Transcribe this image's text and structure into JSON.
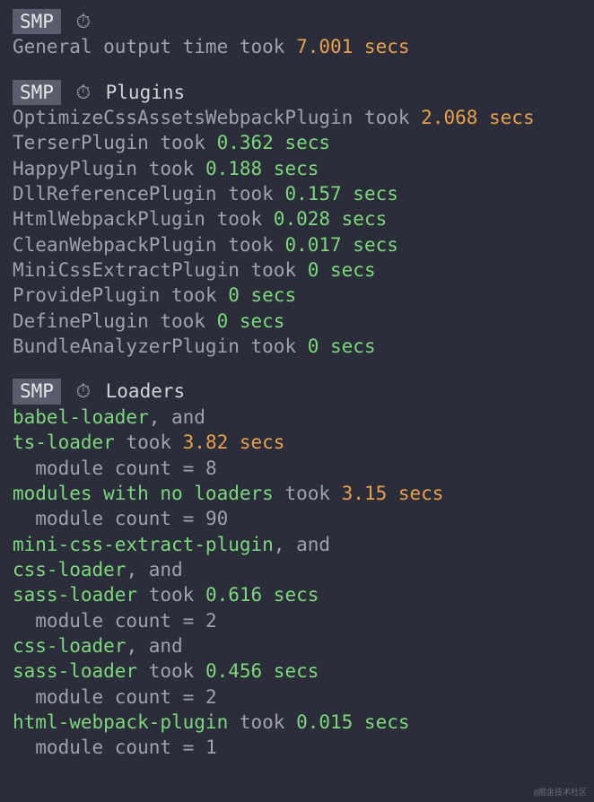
{
  "general": {
    "badge": "SMP",
    "label_prefix": "General output time took ",
    "time": "7.001 secs"
  },
  "plugins": {
    "badge": "SMP",
    "header": "Plugins",
    "items": [
      {
        "name": "OptimizeCssAssetsWebpackPlugin",
        "took": " took ",
        "time": "2.068 secs",
        "color": "orange"
      },
      {
        "name": "TerserPlugin",
        "took": " took ",
        "time": "0.362 secs",
        "color": "green"
      },
      {
        "name": "HappyPlugin",
        "took": " took ",
        "time": "0.188 secs",
        "color": "green"
      },
      {
        "name": "DllReferencePlugin",
        "took": " took ",
        "time": "0.157 secs",
        "color": "green"
      },
      {
        "name": "HtmlWebpackPlugin",
        "took": " took ",
        "time": "0.028 secs",
        "color": "green"
      },
      {
        "name": "CleanWebpackPlugin",
        "took": " took ",
        "time": "0.017 secs",
        "color": "green"
      },
      {
        "name": "MiniCssExtractPlugin",
        "took": " took ",
        "time": "0 secs",
        "color": "green"
      },
      {
        "name": "ProvidePlugin",
        "took": " took ",
        "time": "0 secs",
        "color": "green"
      },
      {
        "name": "DefinePlugin",
        "took": " took ",
        "time": "0 secs",
        "color": "green"
      },
      {
        "name": "BundleAnalyzerPlugin",
        "took": " took ",
        "time": "0 secs",
        "color": "green"
      }
    ]
  },
  "loaders": {
    "badge": "SMP",
    "header": "Loaders",
    "groups": [
      {
        "loaders": [
          {
            "name": "babel-loader",
            "suffix": ", and"
          },
          {
            "name": "ts-loader",
            "suffix": ""
          }
        ],
        "took": " took ",
        "time": "3.82 secs",
        "color": "orange",
        "module_count_label": "module count = ",
        "module_count": "8"
      },
      {
        "loaders": [
          {
            "name": "modules with no loaders",
            "suffix": ""
          }
        ],
        "took": " took ",
        "time": "3.15 secs",
        "color": "orange",
        "module_count_label": "module count = ",
        "module_count": "90"
      },
      {
        "loaders": [
          {
            "name": "mini-css-extract-plugin",
            "suffix": ", and"
          },
          {
            "name": "css-loader",
            "suffix": ", and"
          },
          {
            "name": "sass-loader",
            "suffix": ""
          }
        ],
        "took": " took ",
        "time": "0.616 secs",
        "color": "green",
        "module_count_label": "module count = ",
        "module_count": "2"
      },
      {
        "loaders": [
          {
            "name": "css-loader",
            "suffix": ", and"
          },
          {
            "name": "sass-loader",
            "suffix": ""
          }
        ],
        "took": " took ",
        "time": "0.456 secs",
        "color": "green",
        "module_count_label": "module count = ",
        "module_count": "2"
      },
      {
        "loaders": [
          {
            "name": "html-webpack-plugin",
            "suffix": ""
          }
        ],
        "took": " took ",
        "time": "0.015 secs",
        "color": "green",
        "module_count_label": "module count = ",
        "module_count": "1"
      }
    ]
  },
  "watermark": "@掘金技术社区"
}
